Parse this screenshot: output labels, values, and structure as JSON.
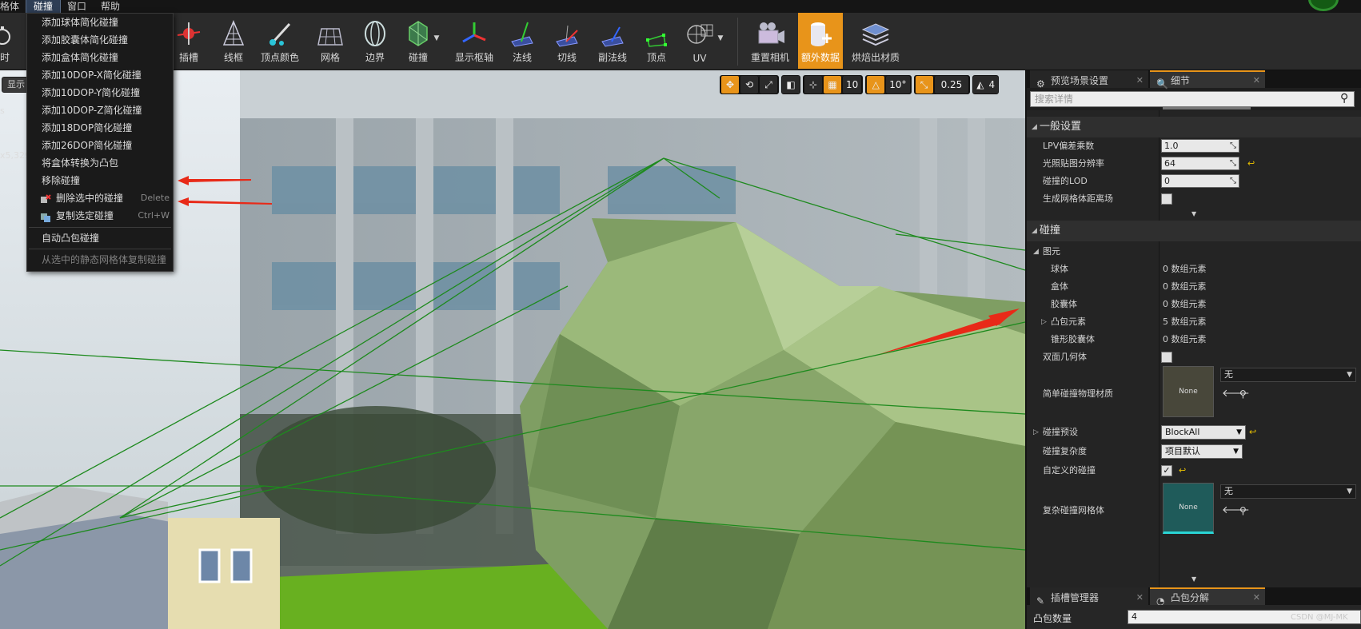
{
  "menubar": {
    "items": [
      "格体",
      "碰撞",
      "窗口",
      "帮助"
    ]
  },
  "toolbar": {
    "buttons": [
      {
        "label": "时",
        "name": "clock-button"
      },
      {
        "label": "插槽",
        "name": "sockets-button"
      },
      {
        "label": "线框",
        "name": "wireframe-button"
      },
      {
        "label": "顶点颜色",
        "name": "vertex-colors-button"
      },
      {
        "label": "网格",
        "name": "grid-button"
      },
      {
        "label": "边界",
        "name": "bounds-button"
      },
      {
        "label": "碰撞",
        "name": "collision-button"
      },
      {
        "label": "显示枢轴",
        "name": "show-pivot-button"
      },
      {
        "label": "法线",
        "name": "normals-button"
      },
      {
        "label": "切线",
        "name": "tangents-button"
      },
      {
        "label": "副法线",
        "name": "binormals-button"
      },
      {
        "label": "顶点",
        "name": "vertices-button"
      },
      {
        "label": "UV",
        "name": "uv-button"
      },
      {
        "label": "重置相机",
        "name": "reset-camera-button"
      },
      {
        "label": "额外数据",
        "name": "additional-data-button"
      },
      {
        "label": "烘焙出材质",
        "name": "bake-materials-button"
      }
    ]
  },
  "collision_menu": {
    "items": [
      {
        "label": "添加球体简化碰撞"
      },
      {
        "label": "添加胶囊体简化碰撞"
      },
      {
        "label": "添加盒体简化碰撞"
      },
      {
        "label": "添加10DOP-X简化碰撞"
      },
      {
        "label": "添加10DOP-Y简化碰撞"
      },
      {
        "label": "添加10DOP-Z简化碰撞"
      },
      {
        "label": "添加18DOP简化碰撞"
      },
      {
        "label": "添加26DOP简化碰撞"
      },
      {
        "label": "将盒体转换为凸包"
      },
      {
        "label": "移除碰撞"
      },
      {
        "label": "删除选中的碰撞",
        "shortcut": "Delete"
      },
      {
        "label": "复制选定碰撞",
        "shortcut": "Ctrl+W"
      },
      {
        "label": "自动凸包碰撞"
      },
      {
        "label": "从选中的静态网格体复制碰撞"
      }
    ]
  },
  "viewport": {
    "show_label": "显示",
    "left_info": [
      "s",
      "x5,329"
    ],
    "toolbar": {
      "grid_snap": "10",
      "rot_snap": "10°",
      "scale_snap": "0.25",
      "cam_speed": "4"
    }
  },
  "tabs": {
    "preview_scene": "预览场景设置",
    "details": "细节"
  },
  "search_placeholder": "搜索详情",
  "general": {
    "title": "一般设置",
    "lpv_label": "LPV偏差乘数",
    "lpv_value": "1.0",
    "lightmap_label": "光照贴图分辨率",
    "lightmap_value": "64",
    "lod_label": "碰撞的LOD",
    "lod_value": "0",
    "distfield_label": "生成网格体距离场"
  },
  "collision": {
    "title": "碰撞",
    "primitives": "图元",
    "sphere_label": "球体",
    "sphere_value": "0 数组元素",
    "box_label": "盒体",
    "box_value": "0 数组元素",
    "capsule_label": "胶囊体",
    "capsule_value": "0 数组元素",
    "convex_label": "凸包元素",
    "convex_value": "5 数组元素",
    "tapered_label": "锥形胶囊体",
    "tapered_value": "0 数组元素",
    "double_sided_label": "双面几何体",
    "phys_mat_label": "简单碰撞物理材质",
    "phys_mat_thumb": "None",
    "phys_mat_value": "无",
    "preset_label": "碰撞预设",
    "preset_value": "BlockAll",
    "complexity_label": "碰撞复杂度",
    "complexity_value": "项目默认",
    "custom_label": "自定义的碰撞",
    "complex_mesh_label": "复杂碰撞网格体",
    "complex_mesh_thumb": "None",
    "complex_mesh_value": "无"
  },
  "bottom_tabs": {
    "socket_manager": "插槽管理器",
    "convex_decomp": "凸包分解"
  },
  "convex_count": {
    "label": "凸包数量",
    "value": "4"
  },
  "watermark": "CSDN @MJ-MK"
}
